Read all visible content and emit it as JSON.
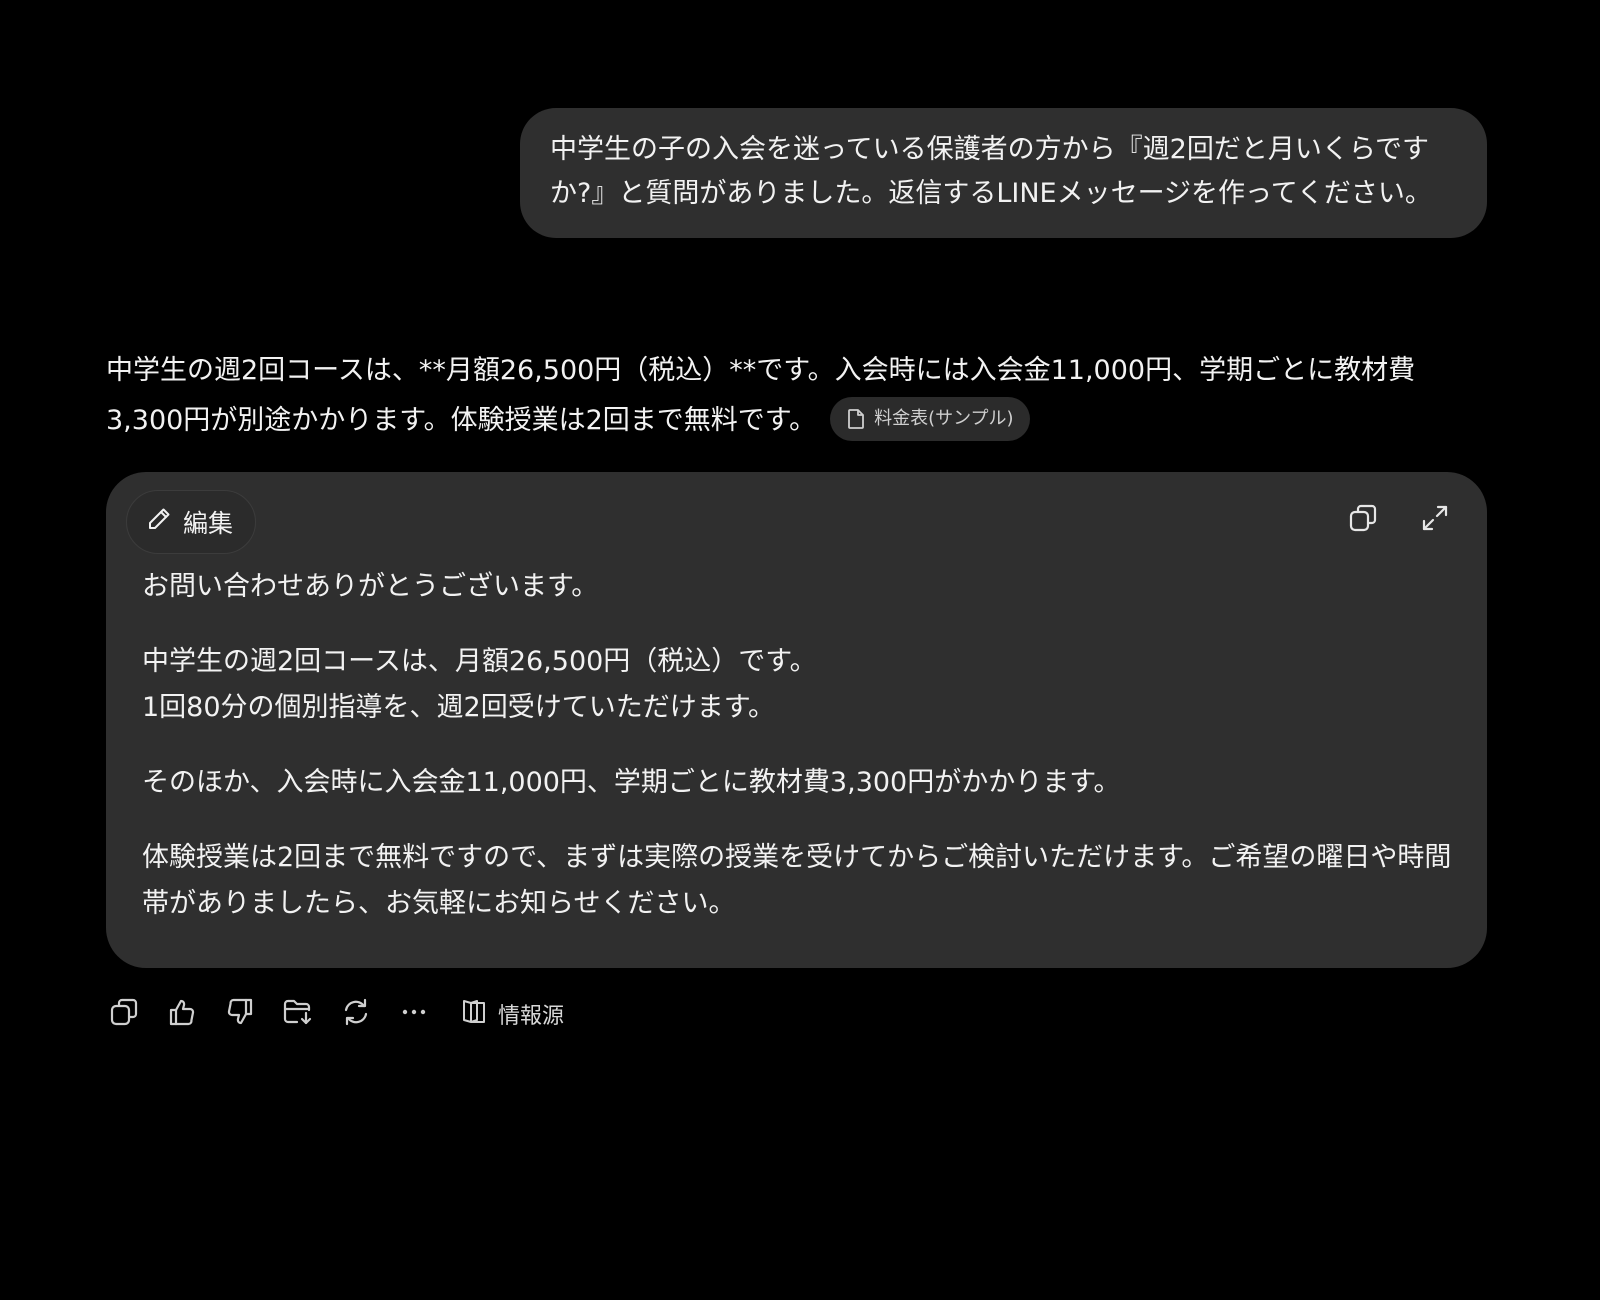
{
  "user_message": {
    "text": "中学生の子の入会を迷っている保護者の方から『週2回だと月いくらですか?』と質問がありました。返信するLINEメッセージを作ってください。"
  },
  "assistant": {
    "intro_text": "中学生の週2回コースは、**月額26,500円（税込）**です。入会時には入会金11,000円、学期ごとに教材費3,300円が別途かかります。体験授業は2回まで無料です。",
    "source_chip_label": "料金表(サンプル)"
  },
  "canvas": {
    "edit_label": "編集",
    "paragraphs": [
      [
        "お問い合わせありがとうございます。"
      ],
      [
        "中学生の週2回コースは、月額26,500円（税込）です。",
        "1回80分の個別指導を、週2回受けていただけます。"
      ],
      [
        "そのほか、入会時に入会金11,000円、学期ごとに教材費3,300円がかかります。"
      ],
      [
        "体験授業は2回まで無料ですので、まずは実際の授業を受けてからご検討いただけます。ご希望の曜日や時間帯がありましたら、お気軽にお知らせください。"
      ]
    ]
  },
  "actions": {
    "sources_label": "情報源"
  },
  "icons": {
    "copy": "copy-icon",
    "thumbs_up": "thumbs-up-icon",
    "thumbs_down": "thumbs-down-icon",
    "save_folder": "folder-download-icon",
    "regenerate": "regenerate-icon",
    "more": "more-dots-icon",
    "sources": "book-open-icon",
    "edit": "pencil-icon",
    "expand": "expand-icon",
    "document": "document-icon"
  },
  "colors": {
    "background": "#000000",
    "bubble": "#2f2f2f",
    "text": "#f2f2f2"
  }
}
